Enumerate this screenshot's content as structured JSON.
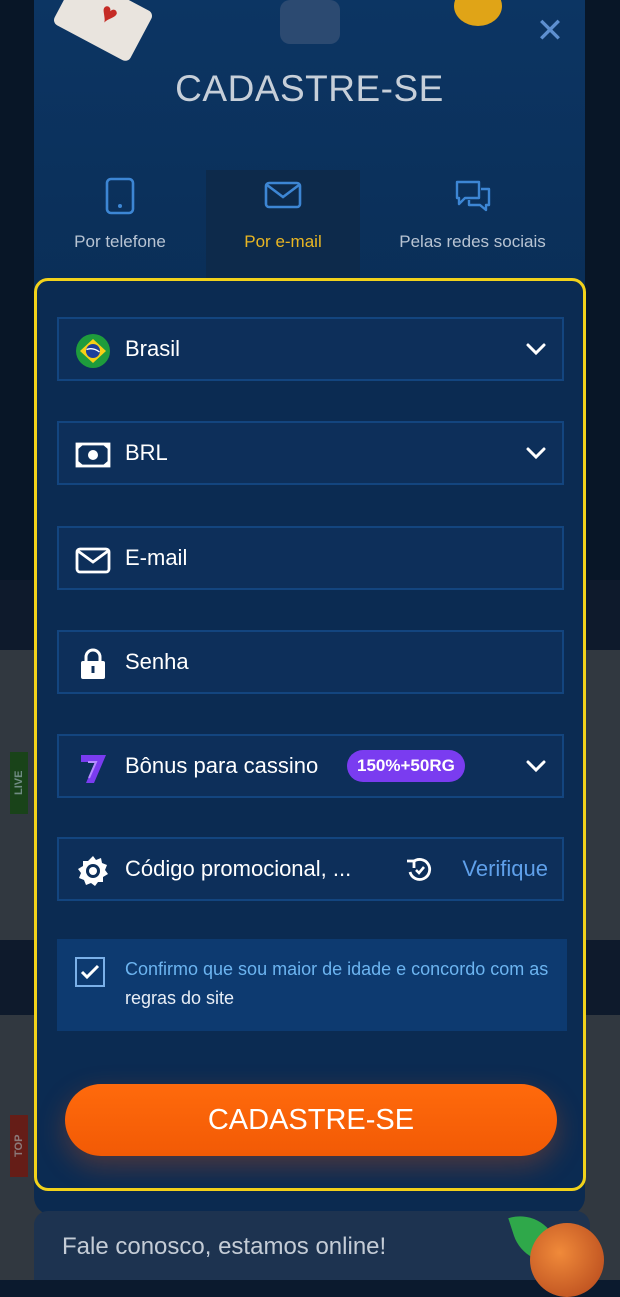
{
  "modal": {
    "title": "CADASTRE-SE",
    "close_icon": "close-icon"
  },
  "tabs": [
    {
      "label": "Por telefone",
      "icon": "phone-icon",
      "active": false
    },
    {
      "label": "Por e-mail",
      "icon": "mail-icon",
      "active": true
    },
    {
      "label": "Pelas redes sociais",
      "icon": "chat-bubbles-icon",
      "active": false
    }
  ],
  "form": {
    "country": {
      "value": "Brasil",
      "icon": "brazil-flag-icon"
    },
    "currency": {
      "value": "BRL",
      "icon": "banknote-icon"
    },
    "email": {
      "placeholder": "E-mail",
      "icon": "mail-icon"
    },
    "password": {
      "placeholder": "Senha",
      "icon": "lock-icon"
    },
    "bonus": {
      "label": "Bônus para cassino",
      "badge": "150%+50RG",
      "icon": "seven-icon"
    },
    "promo": {
      "placeholder": "Código promocional, ...",
      "action": "Verifique",
      "icon": "gear-icon"
    },
    "consent": {
      "text": "Confirmo que sou maior de idade e concordo com as",
      "link": "regras do site",
      "checked": true
    },
    "submit_label": "CADASTRE-SE"
  },
  "background": {
    "live_badge": "LIVE",
    "top_badge": "TOP"
  },
  "chat": {
    "text": "Fale conosco, estamos online!"
  },
  "colors": {
    "accent_yellow": "#f2d21b",
    "submit_orange": "#ff6a0c",
    "link_blue": "#5fa0ea",
    "badge_purple": "#7a3cf0"
  }
}
